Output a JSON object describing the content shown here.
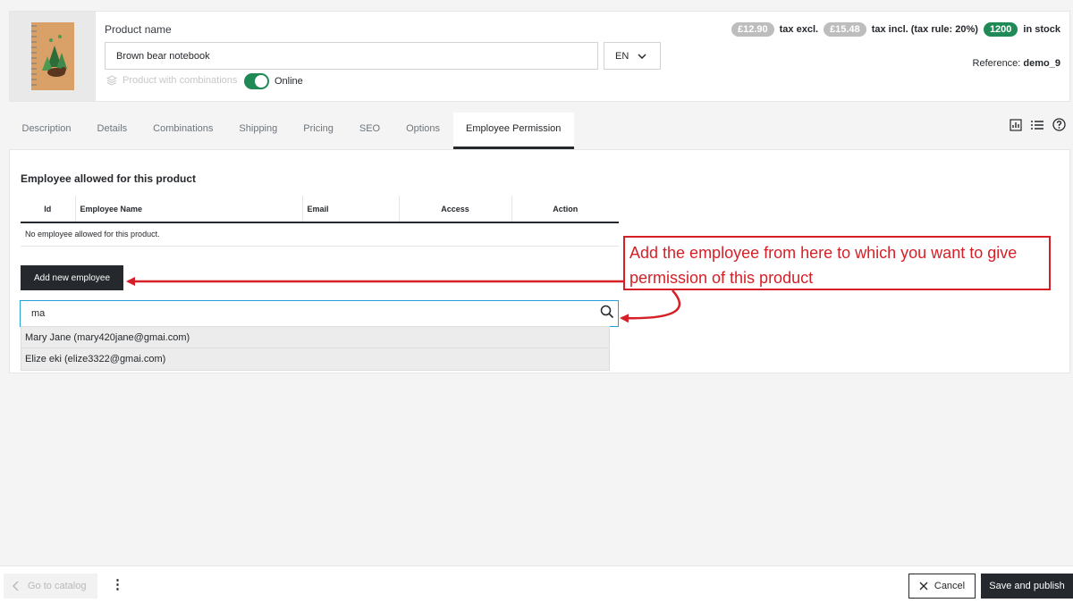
{
  "product": {
    "name_label": "Product name",
    "name_value": "Brown bear notebook",
    "language": "EN",
    "combinations_label": "Product with combinations",
    "status_label": "Online"
  },
  "prices": {
    "tax_excl_value": "£12.90",
    "tax_excl_label": "tax excl.",
    "tax_incl_value": "£15.48",
    "tax_incl_label": "tax incl. (tax rule: 20%)",
    "stock_value": "1200",
    "stock_label": "in stock"
  },
  "reference": {
    "label": "Reference:",
    "value": "demo_9"
  },
  "tabs": [
    {
      "label": "Description"
    },
    {
      "label": "Details"
    },
    {
      "label": "Combinations"
    },
    {
      "label": "Shipping"
    },
    {
      "label": "Pricing"
    },
    {
      "label": "SEO"
    },
    {
      "label": "Options"
    },
    {
      "label": "Employee Permission"
    }
  ],
  "active_tab": "Employee Permission",
  "employees": {
    "title": "Employee allowed for this product",
    "columns": [
      "Id",
      "Employee Name",
      "Email",
      "Access",
      "Action"
    ],
    "empty_text": "No employee allowed for this product.",
    "add_button": "Add new employee",
    "search_value": "ma",
    "suggestions": [
      "Mary Jane (mary420jane@gmai.com)",
      "Elize eki (elize3322@gmai.com)"
    ]
  },
  "annotation": {
    "text": "Add the employee from here to which you want to give permission of this product",
    "color": "#d61f26"
  },
  "footer": {
    "goto_catalog": "Go to catalog",
    "cancel": "Cancel",
    "save_publish": "Save and publish"
  },
  "colors": {
    "accent_green": "#1f8a55",
    "dark": "#25282c",
    "price_pill": "#bdbdbd"
  }
}
